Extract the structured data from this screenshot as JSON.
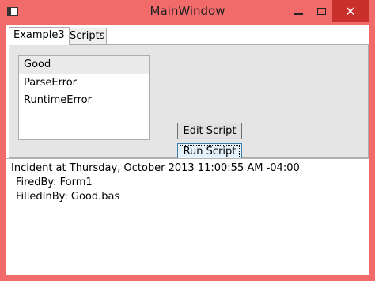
{
  "window": {
    "title": "MainWindow",
    "close_glyph": "✕"
  },
  "tabs": [
    {
      "label": "Example3",
      "selected": true
    },
    {
      "label": "Scripts",
      "selected": false
    }
  ],
  "scripts_list": {
    "items": [
      "Good",
      "ParseError",
      "RuntimeError"
    ],
    "selected_index": 0
  },
  "buttons": {
    "edit_label": "Edit Script",
    "run_label": "Run Script"
  },
  "log": {
    "lines": [
      "Incident at Thursday, October 2013 11:00:55 AM -04:00",
      "FiredBy: Form1",
      "FilledInBy: Good.bas"
    ]
  },
  "colors": {
    "window_frame": "#f26b6b",
    "close_button": "#c9302c",
    "panel_bg": "#e5e5e5"
  }
}
